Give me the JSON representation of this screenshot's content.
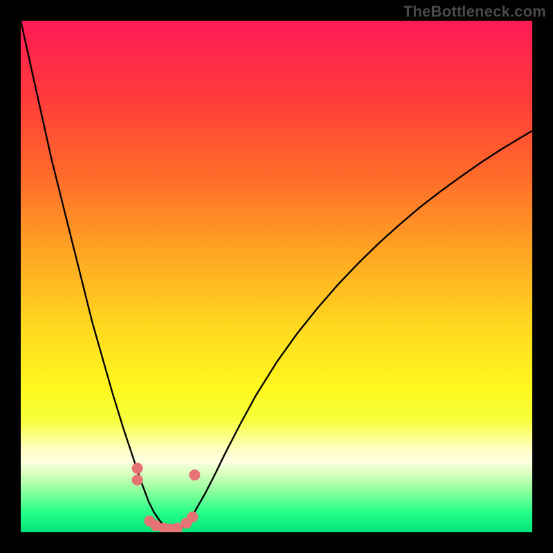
{
  "watermark": "TheBottleneck.com",
  "frame": {
    "outer_w": 800,
    "outer_h": 800,
    "inner_x": 30,
    "inner_y": 30,
    "inner_w": 740,
    "inner_h": 740
  },
  "gradient": {
    "stops": [
      {
        "offset": 0.0,
        "color": "#ff1a55"
      },
      {
        "offset": 0.15,
        "color": "#ff3b3b"
      },
      {
        "offset": 0.3,
        "color": "#ff6a2a"
      },
      {
        "offset": 0.45,
        "color": "#ffa423"
      },
      {
        "offset": 0.6,
        "color": "#ffd91f"
      },
      {
        "offset": 0.72,
        "color": "#fff81f"
      },
      {
        "offset": 0.78,
        "color": "#f7ff3a"
      },
      {
        "offset": 0.835,
        "color": "#ffffbc"
      },
      {
        "offset": 0.86,
        "color": "#ffffe2"
      },
      {
        "offset": 0.885,
        "color": "#d9ffc0"
      },
      {
        "offset": 0.92,
        "color": "#8cff9c"
      },
      {
        "offset": 0.96,
        "color": "#29ff8a"
      },
      {
        "offset": 1.0,
        "color": "#00e57a"
      }
    ]
  },
  "chart_data": {
    "type": "line",
    "title": "",
    "xlabel": "",
    "ylabel": "",
    "xlim": [
      0,
      100
    ],
    "ylim": [
      0,
      100
    ],
    "series": [
      {
        "name": "curve",
        "color": "#000000",
        "x": [
          0,
          2,
          4,
          6,
          8,
          10,
          12,
          14,
          16,
          18,
          20,
          22,
          23.5,
          25,
          26,
          27,
          28,
          29,
          30,
          31,
          32,
          33,
          34,
          36,
          38,
          40,
          43,
          46,
          50,
          54,
          58,
          62,
          66,
          70,
          74,
          78,
          82,
          86,
          90,
          94,
          98,
          100
        ],
        "values": [
          100,
          91,
          82,
          73,
          65,
          57,
          49,
          41,
          34,
          27,
          20.5,
          14.5,
          10,
          6,
          4,
          2.5,
          1.3,
          0.6,
          0.25,
          0.5,
          1.2,
          2.4,
          4,
          7.5,
          11.4,
          15.5,
          21.3,
          26.8,
          33.2,
          38.8,
          43.8,
          48.4,
          52.6,
          56.5,
          60.1,
          63.5,
          66.6,
          69.5,
          72.3,
          74.9,
          77.3,
          78.5
        ]
      }
    ],
    "markers": {
      "name": "bottom-cluster",
      "color": "#e57373",
      "radius": 8,
      "points": [
        {
          "x": 22.8,
          "y": 12.5
        },
        {
          "x": 22.8,
          "y": 10.2
        },
        {
          "x": 25.2,
          "y": 2.2
        },
        {
          "x": 26.4,
          "y": 1.3
        },
        {
          "x": 28.0,
          "y": 0.8
        },
        {
          "x": 29.2,
          "y": 0.6
        },
        {
          "x": 30.6,
          "y": 0.8
        },
        {
          "x": 32.4,
          "y": 1.8
        },
        {
          "x": 33.6,
          "y": 3.0
        },
        {
          "x": 34.0,
          "y": 11.2
        }
      ]
    }
  }
}
